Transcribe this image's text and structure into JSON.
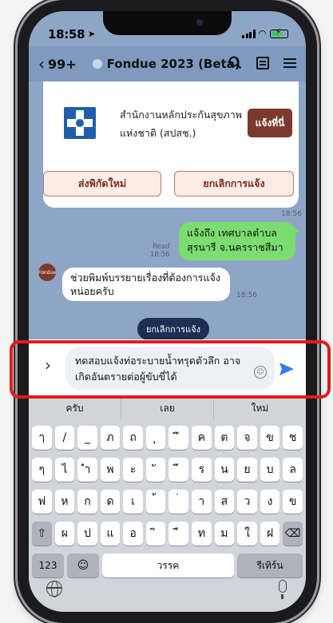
{
  "status": {
    "time": "18:58",
    "battery_color": "#46c757"
  },
  "header": {
    "back_count": "99+",
    "title": "Fondue 2023 (Beta)"
  },
  "card": {
    "org_name": "สำนักงานหลักประกันสุขภาพแห่งชาติ (สปสช.)",
    "where_button": "แจ้งที่นี่",
    "new_location_button": "ส่งพิกัดใหม่",
    "cancel_report_button": "ยกเลิกการแจ้ง",
    "timestamp": "18:56"
  },
  "messages": [
    {
      "direction": "out",
      "text": "แจ้งถึง เทศบาลตำบลสุรนารี จ.นครราชสีมา",
      "read_label": "Read",
      "time": "18:56"
    },
    {
      "direction": "in",
      "sender": "Fondue",
      "text": "ช่วยพิมพ์บรรยายเรื่องที่ต้องการแจ้งหน่อยครับ",
      "time": "18:56"
    }
  ],
  "quick_reply": "ยกเลิกการแจ้ง",
  "input": {
    "value": "ทดสอบแจ้งท่อระบายน้ำทรุดตัวลึก อาจเกิดอันตรายต่อผู้ขับขี่ได้"
  },
  "keyboard": {
    "suggestions": [
      "ครับ",
      "เลย",
      "ใหม่"
    ],
    "rows": [
      [
        "ๅ",
        "/",
        "_",
        "ภ",
        "ถ",
        "ุ",
        "ึ",
        "ค",
        "ต",
        "จ",
        "ข",
        "ช"
      ],
      [
        "ๆ",
        "ไ",
        "ำ",
        "พ",
        "ะ",
        "ั",
        "ี",
        "ร",
        "น",
        "ย",
        "บ",
        "ล"
      ],
      [
        "ฟ",
        "ห",
        "ก",
        "ด",
        "เ",
        "้",
        "่",
        "า",
        "ส",
        "ว",
        "ง",
        "ข"
      ],
      [
        "⇧",
        "ผ",
        "ป",
        "แ",
        "อ",
        "ิ",
        "ื",
        "ท",
        "ม",
        "ใ",
        "ฝ",
        "⌫"
      ]
    ],
    "numbers_key": "123",
    "space_label": "วรรค",
    "return_label": "รีเทิร์น"
  }
}
